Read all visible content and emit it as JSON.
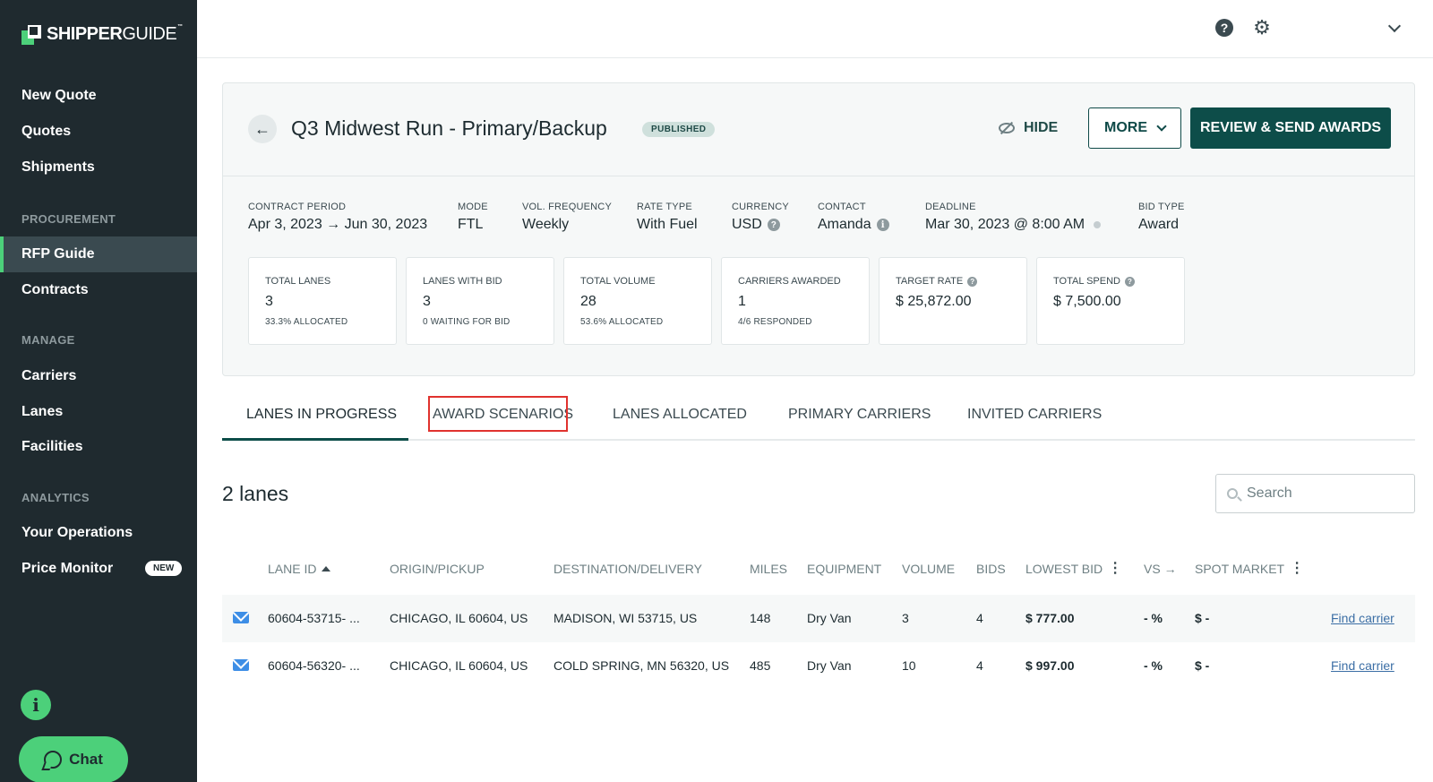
{
  "brand": {
    "strong": "SHIPPER",
    "light": "GUIDE",
    "tm": "™"
  },
  "sidebar": {
    "top_items": [
      {
        "label": "New Quote"
      },
      {
        "label": "Quotes"
      },
      {
        "label": "Shipments"
      }
    ],
    "sections": [
      {
        "title": "PROCUREMENT",
        "items": [
          {
            "label": "RFP Guide",
            "active": true
          },
          {
            "label": "Contracts"
          }
        ]
      },
      {
        "title": "MANAGE",
        "items": [
          {
            "label": "Carriers"
          },
          {
            "label": "Lanes"
          },
          {
            "label": "Facilities"
          }
        ]
      },
      {
        "title": "ANALYTICS",
        "items": [
          {
            "label": "Your Operations"
          },
          {
            "label": "Price Monitor",
            "badge": "NEW"
          }
        ]
      }
    ],
    "info_icon": "i",
    "chat_label": "Chat"
  },
  "topbar": {
    "help_icon": "?",
    "gear_icon": "⚙"
  },
  "rfp": {
    "back_icon": "←",
    "title": "Q3 Midwest Run - Primary/Backup",
    "status": "PUBLISHED",
    "hide_label": "HIDE",
    "more_label": "MORE",
    "review_label": "REVIEW & SEND AWARDS",
    "meta": [
      {
        "label": "CONTRACT PERIOD",
        "value": "Apr 3, 2023 → Jun 30, 2023"
      },
      {
        "label": "MODE",
        "value": "FTL"
      },
      {
        "label": "VOL. FREQUENCY",
        "value": "Weekly"
      },
      {
        "label": "RATE TYPE",
        "value": "With Fuel"
      },
      {
        "label": "CURRENCY",
        "value": "USD"
      },
      {
        "label": "CONTACT",
        "value": "Amanda"
      },
      {
        "label": "DEADLINE",
        "value": "Mar 30, 2023 @ 8:00 AM"
      },
      {
        "label": "BID TYPE",
        "value": "Award"
      }
    ],
    "stats": [
      {
        "label": "TOTAL LANES",
        "value": "3",
        "sub": "33.3% ALLOCATED"
      },
      {
        "label": "LANES WITH BID",
        "value": "3",
        "sub": "0 WAITING FOR BID"
      },
      {
        "label": "TOTAL VOLUME",
        "value": "28",
        "sub": "53.6% ALLOCATED"
      },
      {
        "label": "CARRIERS AWARDED",
        "value": "1",
        "sub": "4/6 RESPONDED"
      },
      {
        "label": "TARGET RATE",
        "value": "$ 25,872.00",
        "sub": ""
      },
      {
        "label": "TOTAL SPEND",
        "value": "$ 7,500.00",
        "sub": ""
      }
    ]
  },
  "tabs": [
    {
      "label": "LANES IN PROGRESS",
      "active": true
    },
    {
      "label": "AWARD SCENARIOS",
      "highlighted": true
    },
    {
      "label": "LANES ALLOCATED"
    },
    {
      "label": "PRIMARY CARRIERS"
    },
    {
      "label": "INVITED CARRIERS"
    }
  ],
  "lanes": {
    "count_label": "2 lanes",
    "search_placeholder": "Search",
    "columns": [
      "LANE ID",
      "ORIGIN/PICKUP",
      "DESTINATION/DELIVERY",
      "MILES",
      "EQUIPMENT",
      "VOLUME",
      "BIDS",
      "LOWEST BID",
      "VS →",
      "SPOT MARKET"
    ],
    "rows": [
      {
        "lane_id": "60604-53715- ...",
        "origin": "CHICAGO, IL 60604, US",
        "destination": "MADISON, WI 53715, US",
        "miles": "148",
        "equipment": "Dry Van",
        "volume": "3",
        "bids": "4",
        "lowest_bid": "$ 777.00",
        "vs": "- %",
        "spot": "$ -",
        "action": "Find carrier"
      },
      {
        "lane_id": "60604-56320- ...",
        "origin": "CHICAGO, IL 60604, US",
        "destination": "COLD SPRING, MN 56320, US",
        "miles": "485",
        "equipment": "Dry Van",
        "volume": "10",
        "bids": "4",
        "lowest_bid": "$ 997.00",
        "vs": "- %",
        "spot": "$ -",
        "action": "Find carrier"
      }
    ]
  },
  "colors": {
    "sidebar": "#1f2a2f",
    "accent": "#4cd07a",
    "primary": "#0d4d49",
    "highlight": "#e0322e",
    "mail": "#3d8ee6"
  }
}
